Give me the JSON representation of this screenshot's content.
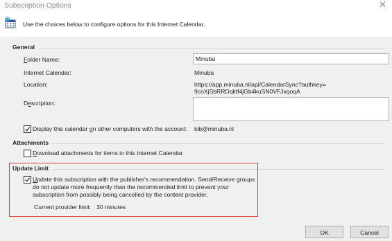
{
  "window": {
    "title": "Subscription Options"
  },
  "intro": {
    "text": "Use the choices below to configure options for this Internet Calendar."
  },
  "general": {
    "title": "General",
    "folder_name_label_u": "F",
    "folder_name_label_rest": "older Name:",
    "folder_name_value": "Minuba",
    "internet_calendar_label": "Internet Calendar:",
    "internet_calendar_value": "Minuba",
    "location_label": "Location:",
    "location_line1": "https://app.minuba.nl/api/CalendarSync?authkey=",
    "location_line2": "9coXjSbRRDqktf4jGb4kuSN0VFJxqoqA",
    "description_label_pre": "D",
    "description_label_u": "e",
    "description_label_rest": "scription:",
    "description_value": "",
    "display_checked": true,
    "display_label_pre": "Display this calendar ",
    "display_label_u": "o",
    "display_label_rest": "n other computers with the account:",
    "account_value": "kib@minuba.nl"
  },
  "attachments": {
    "title": "Attachments",
    "download_checked": false,
    "download_label_u": "D",
    "download_label_rest": "ownload attachments for items in this Internet Calendar"
  },
  "update_limit": {
    "title": "Update Limit",
    "checked": true,
    "line1_u": "U",
    "line1_rest": "pdate this subscription with the publisher's recommendation. Send/Receive groups",
    "line2": "do not update more frequently than the recommended limit to prevent your",
    "line3": "subscription from possibly being cancelled by the content provider.",
    "current_limit_label": "Current provider limit:",
    "current_limit_value": "30 minutes"
  },
  "buttons": {
    "ok_label": "OK",
    "cancel_label": "Cancel"
  },
  "colors": {
    "highlight_box": "#e0393a",
    "dialog_bg": "#f0f0f0"
  }
}
